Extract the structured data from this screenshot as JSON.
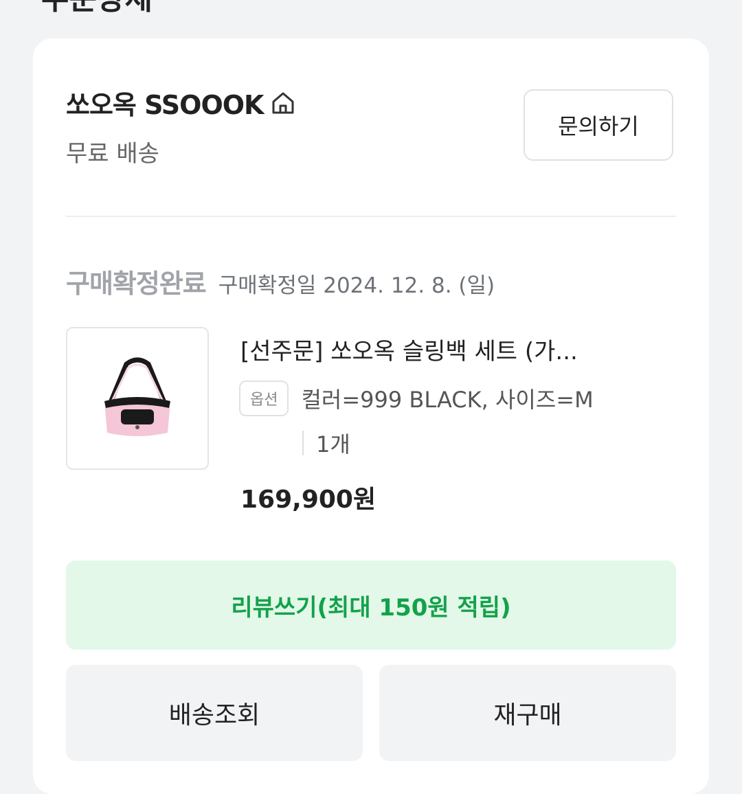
{
  "header": {
    "title_partial": "주문상세"
  },
  "store": {
    "name": "쏘오옥 SSOOOK",
    "shipping": "무료 배송",
    "inquiry_label": "문의하기"
  },
  "order": {
    "status": "구매확정완료",
    "confirm_date": "구매확정일 2024. 12. 8. (일)"
  },
  "product": {
    "title": "[선주문] 쏘오옥 슬링백 세트 (가...",
    "option_badge": "옵션",
    "option_text": "컬러=999 BLACK, 사이즈=M",
    "quantity": "1개",
    "price": "169,900원"
  },
  "actions": {
    "review_label": "리뷰쓰기(최대 150원 적립)",
    "tracking_label": "배송조회",
    "rebuy_label": "재구매"
  },
  "colors": {
    "accent_green": "#13a24a",
    "review_bg": "#e3f8e9",
    "page_bg": "#f2f3f5"
  }
}
